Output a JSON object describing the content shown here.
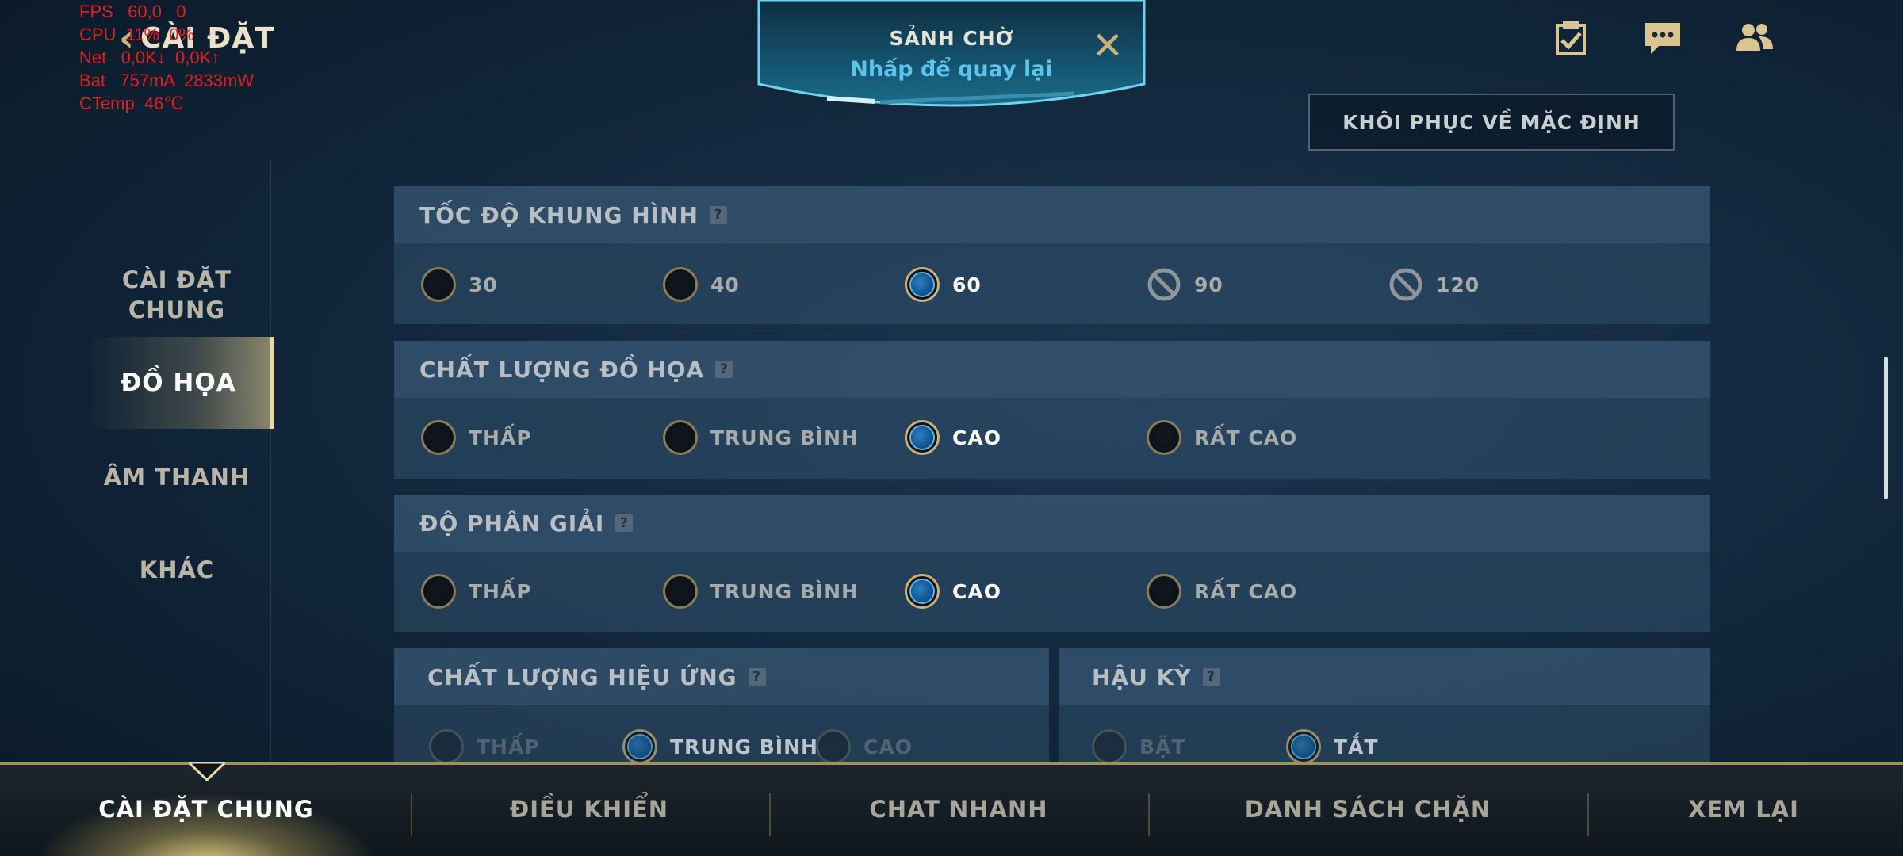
{
  "debug": {
    "lines": [
      "FPS   60,0   0",
      "CPU  11%  0%",
      "Net   0,0K↓  0,0K↑",
      "Bat   757mA  2833mW",
      "CTemp  46℃"
    ]
  },
  "header": {
    "title": "CÀI ĐẶT",
    "back_icon": "chevron-left-icon",
    "lobby": {
      "title": "SẢNH CHỜ",
      "subtitle": "Nhấp để quay lại",
      "close_icon": "close-icon"
    },
    "icons": [
      "missions-icon",
      "chat-icon",
      "friends-icon"
    ],
    "restore_label": "KHÔI PHỤC VỀ MẶC ĐỊNH"
  },
  "nav": {
    "items": [
      "CÀI ĐẶT CHUNG",
      "ĐỒ HỌA",
      "ÂM THANH",
      "KHÁC"
    ],
    "active": "ĐỒ HỌA"
  },
  "sections": {
    "frame_rate": {
      "title": "TỐC ĐỘ KHUNG HÌNH",
      "options": [
        "30",
        "40",
        "60",
        "90",
        "120"
      ],
      "selected": "60",
      "disabled": [
        "90",
        "120"
      ]
    },
    "graphics_quality": {
      "title": "CHẤT LƯỢNG ĐỒ HỌA",
      "options": [
        "THẤP",
        "TRUNG BÌNH",
        "CAO",
        "RẤT CAO"
      ],
      "selected": "CAO"
    },
    "resolution": {
      "title": "ĐỘ PHÂN GIẢI",
      "options": [
        "THẤP",
        "TRUNG BÌNH",
        "CAO",
        "RẤT CAO"
      ],
      "selected": "CAO"
    },
    "effects_quality": {
      "title": "CHẤT LƯỢNG HIỆU ỨNG",
      "options": [
        "THẤP",
        "TRUNG BÌNH",
        "CAO"
      ],
      "selected": "TRUNG BÌNH"
    },
    "post_processing": {
      "title": "HẬU KỲ",
      "options": [
        "BẬT",
        "TẮT"
      ],
      "selected": "TẮT"
    }
  },
  "bottom_tabs": {
    "items": [
      "CÀI ĐẶT CHUNG",
      "ĐIỀU KHIỂN",
      "CHAT NHANH",
      "DANH SÁCH CHẶN",
      "XEM LẠI"
    ],
    "active": "CÀI ĐẶT CHUNG"
  },
  "colors": {
    "accent_gold": "#c9b27a",
    "accent_blue": "#5cc3ea",
    "debug_red": "#e02020"
  }
}
